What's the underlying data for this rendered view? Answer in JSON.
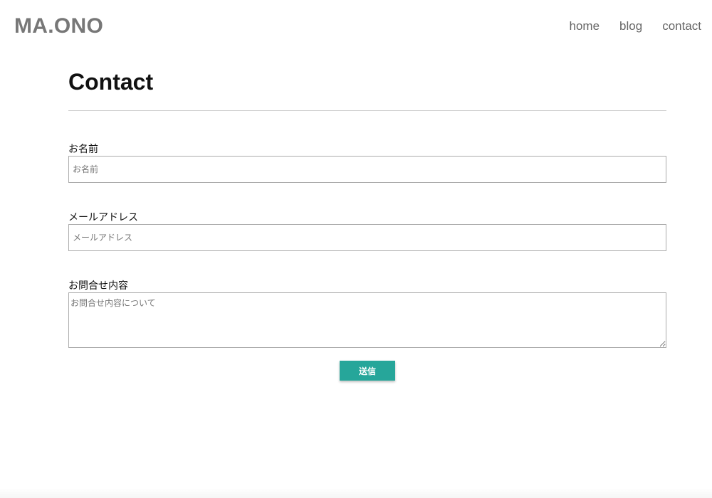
{
  "header": {
    "logo": "MA.ONO",
    "nav": [
      {
        "label": "home"
      },
      {
        "label": "blog"
      },
      {
        "label": "contact"
      }
    ]
  },
  "main": {
    "title": "Contact",
    "form": {
      "name": {
        "label": "お名前",
        "placeholder": "お名前",
        "value": ""
      },
      "email": {
        "label": "メールアドレス",
        "placeholder": "メールアドレス",
        "value": ""
      },
      "message": {
        "label": "お問合せ内容",
        "placeholder": "お問合せ内容について",
        "value": ""
      },
      "submit_label": "送信"
    }
  },
  "colors": {
    "accent": "#26a69a",
    "logo": "#777777",
    "nav_text": "#666666",
    "divider": "#cccccc"
  }
}
